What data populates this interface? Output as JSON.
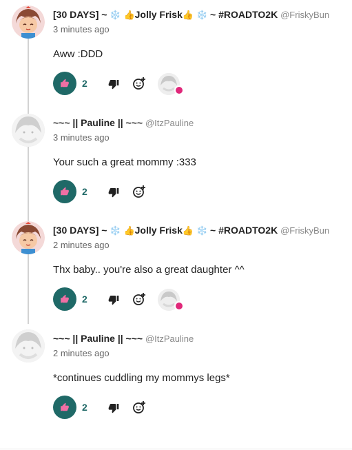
{
  "comments": [
    {
      "avatar": "frisk-avatar",
      "name_prefix": "[30 DAYS] ~",
      "emoji1": "❄️",
      "emoji2": "👍",
      "name_mid": "Jolly Frisk",
      "emoji3": "👍",
      "emoji4": "❄️",
      "name_suffix": "~ #ROADTO2K",
      "handle": "@FriskyBun",
      "time": "3 minutes ago",
      "text": "Aww :DDD",
      "likes": "2",
      "has_reaction": true
    },
    {
      "avatar": "pauline-avatar",
      "name": "~~~ || Pauline || ~~~",
      "handle": "@ItzPauline",
      "time": "3 minutes ago",
      "text": "Your such a great mommy :333",
      "likes": "2",
      "has_reaction": false
    },
    {
      "avatar": "frisk-avatar",
      "name_prefix": "[30 DAYS] ~",
      "emoji1": "❄️",
      "emoji2": "👍",
      "name_mid": "Jolly Frisk",
      "emoji3": "👍",
      "emoji4": "❄️",
      "name_suffix": "~ #ROADTO2K",
      "handle": "@FriskyBun",
      "time": "2 minutes ago",
      "text": "Thx baby.. you're also a great daughter ^^",
      "likes": "2",
      "has_reaction": true
    },
    {
      "avatar": "pauline-avatar",
      "name": "~~~ || Pauline || ~~~",
      "handle": "@ItzPauline",
      "time": "2 minutes ago",
      "text": "*continues cuddling my mommys legs*",
      "likes": "2",
      "has_reaction": false
    }
  ],
  "colors": {
    "like_button_bg": "#1f6967",
    "thumb_icon": "#f06fa4",
    "heart_badge": "#e0287a",
    "thread_line": "#d2d2d2"
  },
  "icons": {
    "like": "thumbs-up-icon",
    "dislike": "thumbs-down-icon",
    "react": "add-reaction-icon",
    "heart": "heart-icon"
  }
}
